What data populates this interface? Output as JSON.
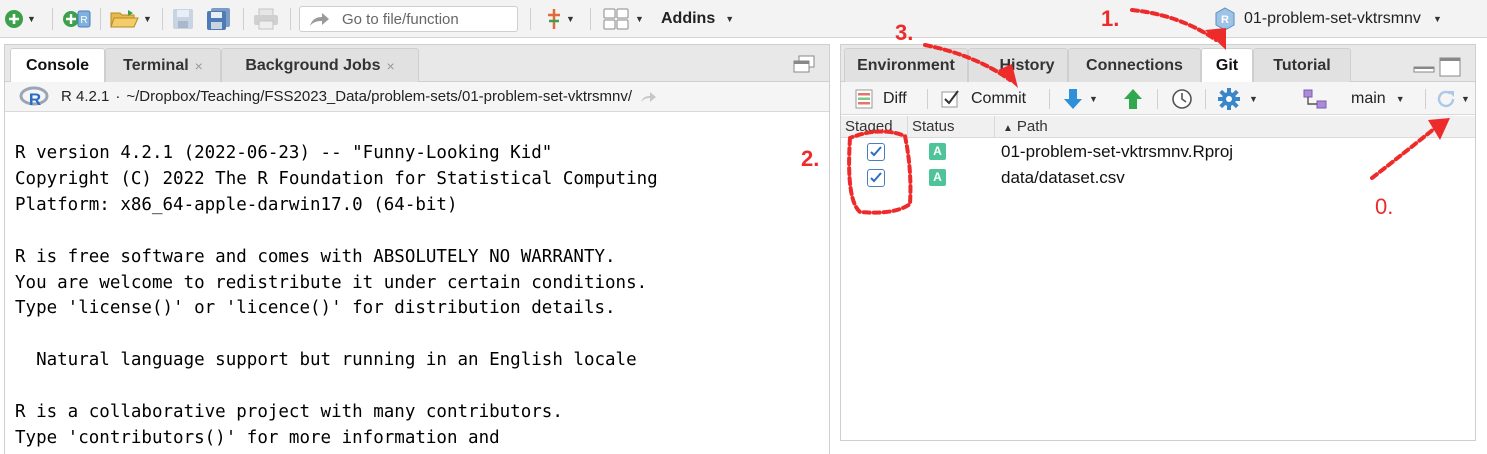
{
  "toolbar": {
    "go_to_file_placeholder": "Go to file/function",
    "addins_label": "Addins",
    "project_name": "01-problem-set-vktrsmnv"
  },
  "console_pane": {
    "tabs": [
      {
        "label": "Console",
        "active": true,
        "closable": false
      },
      {
        "label": "Terminal",
        "active": false,
        "closable": true
      },
      {
        "label": "Background Jobs",
        "active": false,
        "closable": true
      }
    ],
    "close_glyph": "×",
    "r_version": "R 4.2.1",
    "path_separator": "·",
    "working_dir": "~/Dropbox/Teaching/FSS2023_Data/problem-sets/01-problem-set-vktrsmnv/",
    "output_lines": [
      "R version 4.2.1 (2022-06-23) -- \"Funny-Looking Kid\"",
      "Copyright (C) 2022 The R Foundation for Statistical Computing",
      "Platform: x86_64-apple-darwin17.0 (64-bit)",
      "",
      "R is free software and comes with ABSOLUTELY NO WARRANTY.",
      "You are welcome to redistribute it under certain conditions.",
      "Type 'license()' or 'licence()' for distribution details.",
      "",
      "  Natural language support but running in an English locale",
      "",
      "R is a collaborative project with many contributors.",
      "Type 'contributors()' for more information and"
    ]
  },
  "git_pane": {
    "tabs": [
      {
        "label": "Environment",
        "active": false
      },
      {
        "label": "History",
        "active": false
      },
      {
        "label": "Connections",
        "active": false
      },
      {
        "label": "Git",
        "active": true
      },
      {
        "label": "Tutorial",
        "active": false
      }
    ],
    "diff_label": "Diff",
    "commit_label": "Commit",
    "branch": "main",
    "columns": {
      "staged": "Staged",
      "status": "Status",
      "path": "Path"
    },
    "files": [
      {
        "staged": true,
        "status": "A",
        "path": "01-problem-set-vktrsmnv.Rproj"
      },
      {
        "staged": true,
        "status": "A",
        "path": "data/dataset.csv"
      }
    ]
  },
  "annotations": {
    "step0": "0.",
    "step1": "1.",
    "step2": "2.",
    "step3": "3.",
    "color": "#ee2b2b"
  },
  "colors": {
    "accent_blue": "#2f6fbf",
    "status_added": "#4fc39a",
    "pull_arrow": "#2f8fd8",
    "push_arrow": "#2fa84f"
  }
}
